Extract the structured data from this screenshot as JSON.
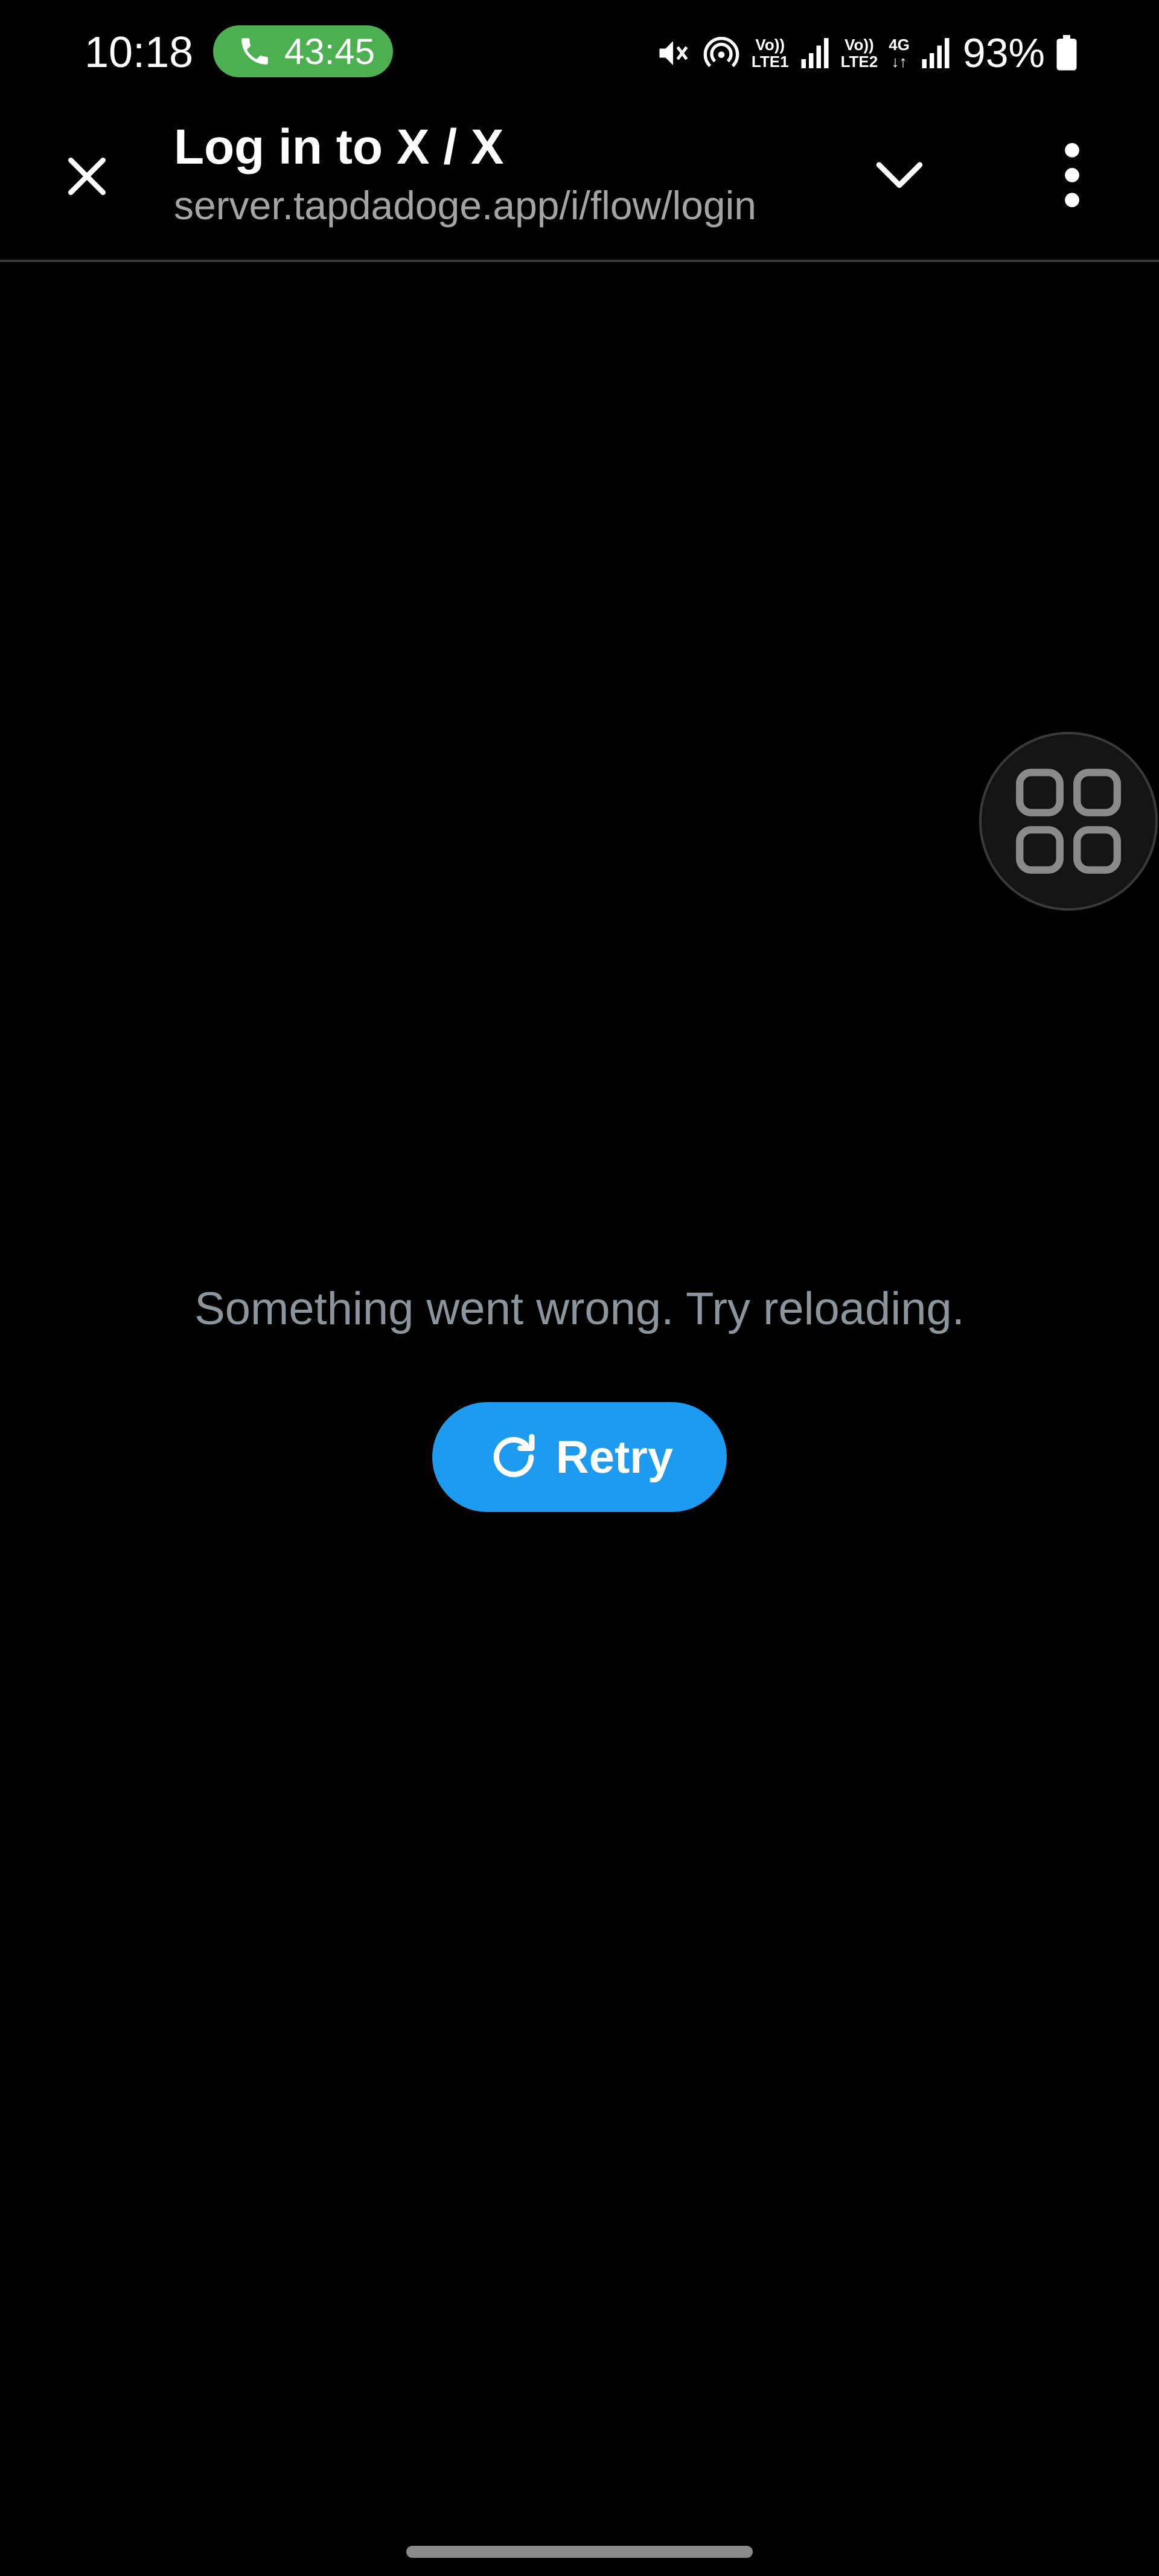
{
  "status_bar": {
    "time": "10:18",
    "call_duration": "43:45",
    "network_1": {
      "top": "Vo))",
      "bottom": "LTE1"
    },
    "network_2": {
      "top": "Vo))",
      "bottom": "LTE2"
    },
    "data_type": "4G",
    "battery_percent": "93%",
    "icons": [
      "phone-icon",
      "mute-icon",
      "hotspot-icon",
      "signal-icon",
      "signal-icon",
      "data-arrows-icon",
      "battery-icon"
    ]
  },
  "toolbar": {
    "title": "Log in to X / X",
    "url": "server.tapdadoge.app/i/flow/login",
    "icons": [
      "close-icon",
      "chevron-down-icon",
      "more-vert-icon"
    ]
  },
  "floating_button": {
    "icon": "grid-icon"
  },
  "error": {
    "message": "Something went wrong. Try reloading.",
    "retry_label": "Retry",
    "retry_icon": "refresh-icon"
  },
  "colors": {
    "background": "#000000",
    "accent": "#1d9bf0",
    "call_pill": "#4caf50",
    "message_text": "#8b959e",
    "url_text": "#a4a4a4"
  }
}
